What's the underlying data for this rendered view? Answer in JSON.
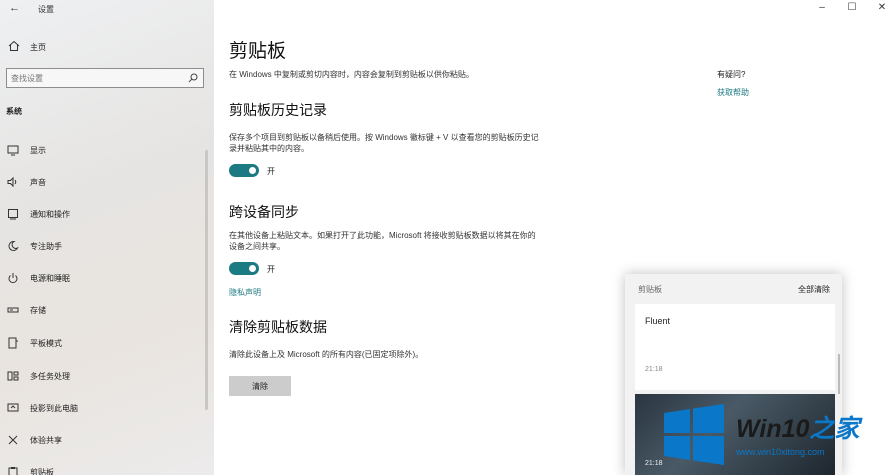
{
  "window": {
    "app_title": "设置",
    "controls": [
      "–",
      "☐",
      "✕"
    ]
  },
  "sidebar": {
    "home_label": "主页",
    "search_placeholder": "查找设置",
    "section": "系统",
    "items": [
      {
        "label": "显示",
        "icon": "monitor-icon"
      },
      {
        "label": "声音",
        "icon": "speaker-icon"
      },
      {
        "label": "通知和操作",
        "icon": "notification-icon"
      },
      {
        "label": "专注助手",
        "icon": "moon-icon"
      },
      {
        "label": "电源和睡眠",
        "icon": "power-icon"
      },
      {
        "label": "存储",
        "icon": "storage-icon"
      },
      {
        "label": "平板模式",
        "icon": "tablet-icon"
      },
      {
        "label": "多任务处理",
        "icon": "multitask-icon"
      },
      {
        "label": "投影到此电脑",
        "icon": "project-icon"
      },
      {
        "label": "体验共享",
        "icon": "share-icon"
      },
      {
        "label": "剪贴板",
        "icon": "clipboard-icon"
      }
    ]
  },
  "main": {
    "title": "剪贴板",
    "description": "在 Windows 中复制或剪切内容时，内容会复制到剪贴板以供你粘贴。",
    "history": {
      "heading": "剪贴板历史记录",
      "description": "保存多个项目到剪贴板以备稍后使用。按 Windows 徽标键 + V 以查看您的剪贴板历史记录并粘贴其中的内容。",
      "toggle_state": "开",
      "toggle_on": true
    },
    "sync": {
      "heading": "跨设备同步",
      "description": "在其他设备上粘贴文本。如果打开了此功能，Microsoft 将接收剪贴板数据以将其在你的设备之间共享。",
      "toggle_state": "开",
      "toggle_on": true,
      "privacy_link": "隐私声明"
    },
    "clear": {
      "heading": "清除剪贴板数据",
      "description": "清除此设备上及 Microsoft 的所有内容(已固定项除外)。",
      "button": "清除"
    },
    "help": {
      "question": "有疑问?",
      "link": "获取帮助"
    }
  },
  "clipboard_panel": {
    "title": "剪贴板",
    "clear_all": "全部清除",
    "items": [
      {
        "text": "Fluent",
        "time": "21:18"
      },
      {
        "text": "",
        "time": "21:18"
      }
    ]
  },
  "watermark": {
    "brand_prefix": "Win10",
    "brand_suffix": "之家",
    "url": "www.win10xitong.com",
    "colors": {
      "blue": "#0a77c9",
      "dark": "#1a1a1a"
    }
  },
  "colors": {
    "accent": "#1c7a82",
    "sidebar_bg": "#ebe8e6"
  }
}
